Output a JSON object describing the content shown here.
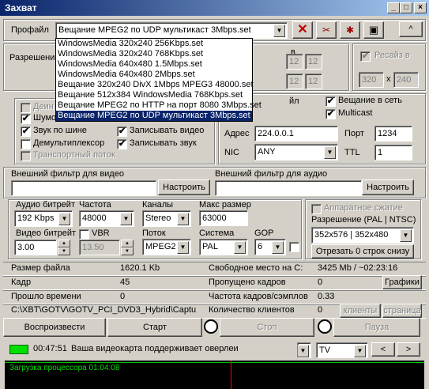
{
  "window": {
    "title": "Захват",
    "min_glyph": "_",
    "max_glyph": "□",
    "close_glyph": "×"
  },
  "profile": {
    "label": "Профайл",
    "value": "Вещание MPEG2 по UDP мультикаст 3Mbps.set",
    "up_glyph": "^",
    "options": [
      "WindowsMedia 320x240 256Kbps.set",
      "WindowsMedia 320x240 768Kbps.set",
      "WindowsMedia 640x480 1.5Mbps.set",
      "WindowsMedia 640x480 2Mbps.set",
      "Вещание 320x240 DivX 1Mbps MPEG3 48000.set",
      "Вещание 512x384 WindowsMedia 768Kbps.set",
      "Вещание MPEG2 по HTTP на порт 8080 3Mbps.set",
      "Вещание MPEG2 по UDP мультикаст 3Mbps.set"
    ]
  },
  "resolution": {
    "label": "Разрешени",
    "partial": "в",
    "v1": "12",
    "v2": "12",
    "v3": "12",
    "v4": "12"
  },
  "resize": {
    "label": "Ресайз в",
    "w": "320",
    "x": "x",
    "h": "240"
  },
  "opts": {
    "deint": "Деин",
    "shum": "Шумо",
    "audio_bus": "Звук по шине",
    "demux": "Демультиплексор",
    "transport": "Транспортный поток",
    "rec_video": "Записывать видео",
    "rec_audio": "Записывать звук",
    "check": "✔"
  },
  "net": {
    "file_partial": "йл",
    "broadcast": "Вещание в сеть",
    "multicast": "Multicast",
    "addr_label": "Адрес",
    "addr": "224.0.0.1",
    "port_label": "Порт",
    "port": "1234",
    "nic_label": "NIC",
    "nic": "ANY",
    "ttl_label": "TTL",
    "ttl": "1"
  },
  "filters": {
    "video_label": "Внешний фильтр для видео",
    "audio_label": "Внешний фильтр для аудио",
    "config": "Настроить"
  },
  "audio": {
    "bitrate_label": "Аудио битрейт",
    "bitrate": "192 Kbps",
    "freq_label": "Частота",
    "freq": "48000",
    "channels_label": "Каналы",
    "channels": "Stereo",
    "max_label": "Макс размер",
    "max": "63000"
  },
  "video": {
    "bitrate_label": "Видео битрейт",
    "bitrate": "3.00",
    "vbr": "VBR",
    "vbr_val": "13.50",
    "stream_label": "Поток",
    "stream": "MPEG2",
    "system_label": "Система",
    "system": "PAL",
    "gop_label": "GOP",
    "gop": "6"
  },
  "hw": {
    "label": "Аппаратное сжатие",
    "res_label": "Разрешение (PAL | NTSC)",
    "res": "352x576 | 352x480",
    "cut": "Отрезать 0 строк снизу"
  },
  "stats": {
    "file_size_label": "Размер файла",
    "file_size": "1620.1 Kb",
    "free_label": "Свободное место на C:",
    "free": "3425 Mb / ~02:23:16",
    "frame_label": "Кадр",
    "frame": "45",
    "skipped_label": "Пропущено кадров",
    "skipped": "0",
    "graphs": "Графики",
    "elapsed_label": "Прошло времени",
    "elapsed": "0",
    "rate_label": "Частота кадров/сэмплов",
    "rate": "0.33",
    "path": "C:\\XBT\\GOTV\\GOTV_PCI_DVD3_Hybrid\\Captu",
    "clients_label": "Количество клиентов",
    "clients": "0",
    "clients_btn": "клиенты",
    "page_btn": "страница"
  },
  "controls": {
    "play": "Воспроизвести",
    "start": "Старт",
    "stop": "Стоп",
    "pause": "Пауза"
  },
  "status": {
    "time": "00:47:51",
    "msg": "Ваша видеокарта поддерживает оверлеи",
    "tv": "TV",
    "prev": "<",
    "next": ">"
  },
  "monitor": {
    "text": "Загрузка процессора  01:04:08",
    "line_color": "#00c000",
    "marker_color": "#ff0000"
  }
}
